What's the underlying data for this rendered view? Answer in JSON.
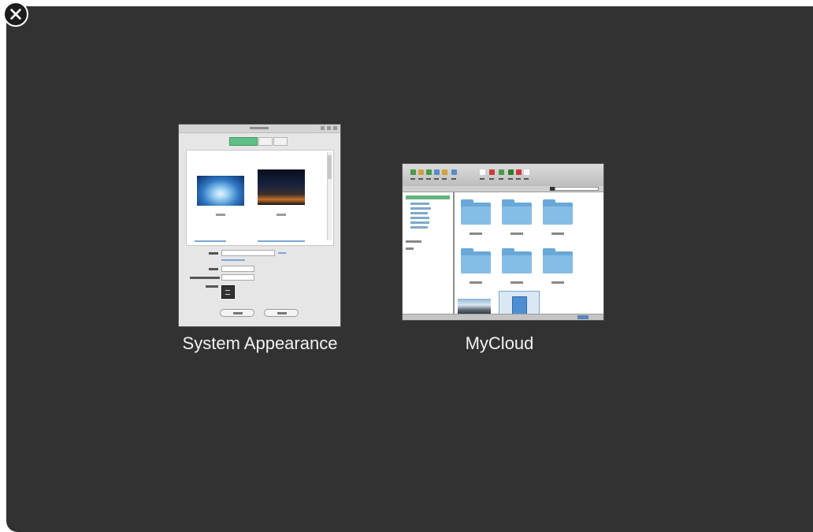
{
  "close_button": {
    "icon": "close-circle-icon"
  },
  "windows": [
    {
      "title": "System Appearance",
      "thumbnail": "system-appearance-window-preview"
    },
    {
      "title": "MyCloud",
      "thumbnail": "mycloud-file-browser-preview"
    }
  ],
  "colors": {
    "overlay_background": "#323232",
    "title_text": "#f2f2f2",
    "accent_tab": "#5fbf85",
    "folder_blue": "#69a8d8"
  }
}
